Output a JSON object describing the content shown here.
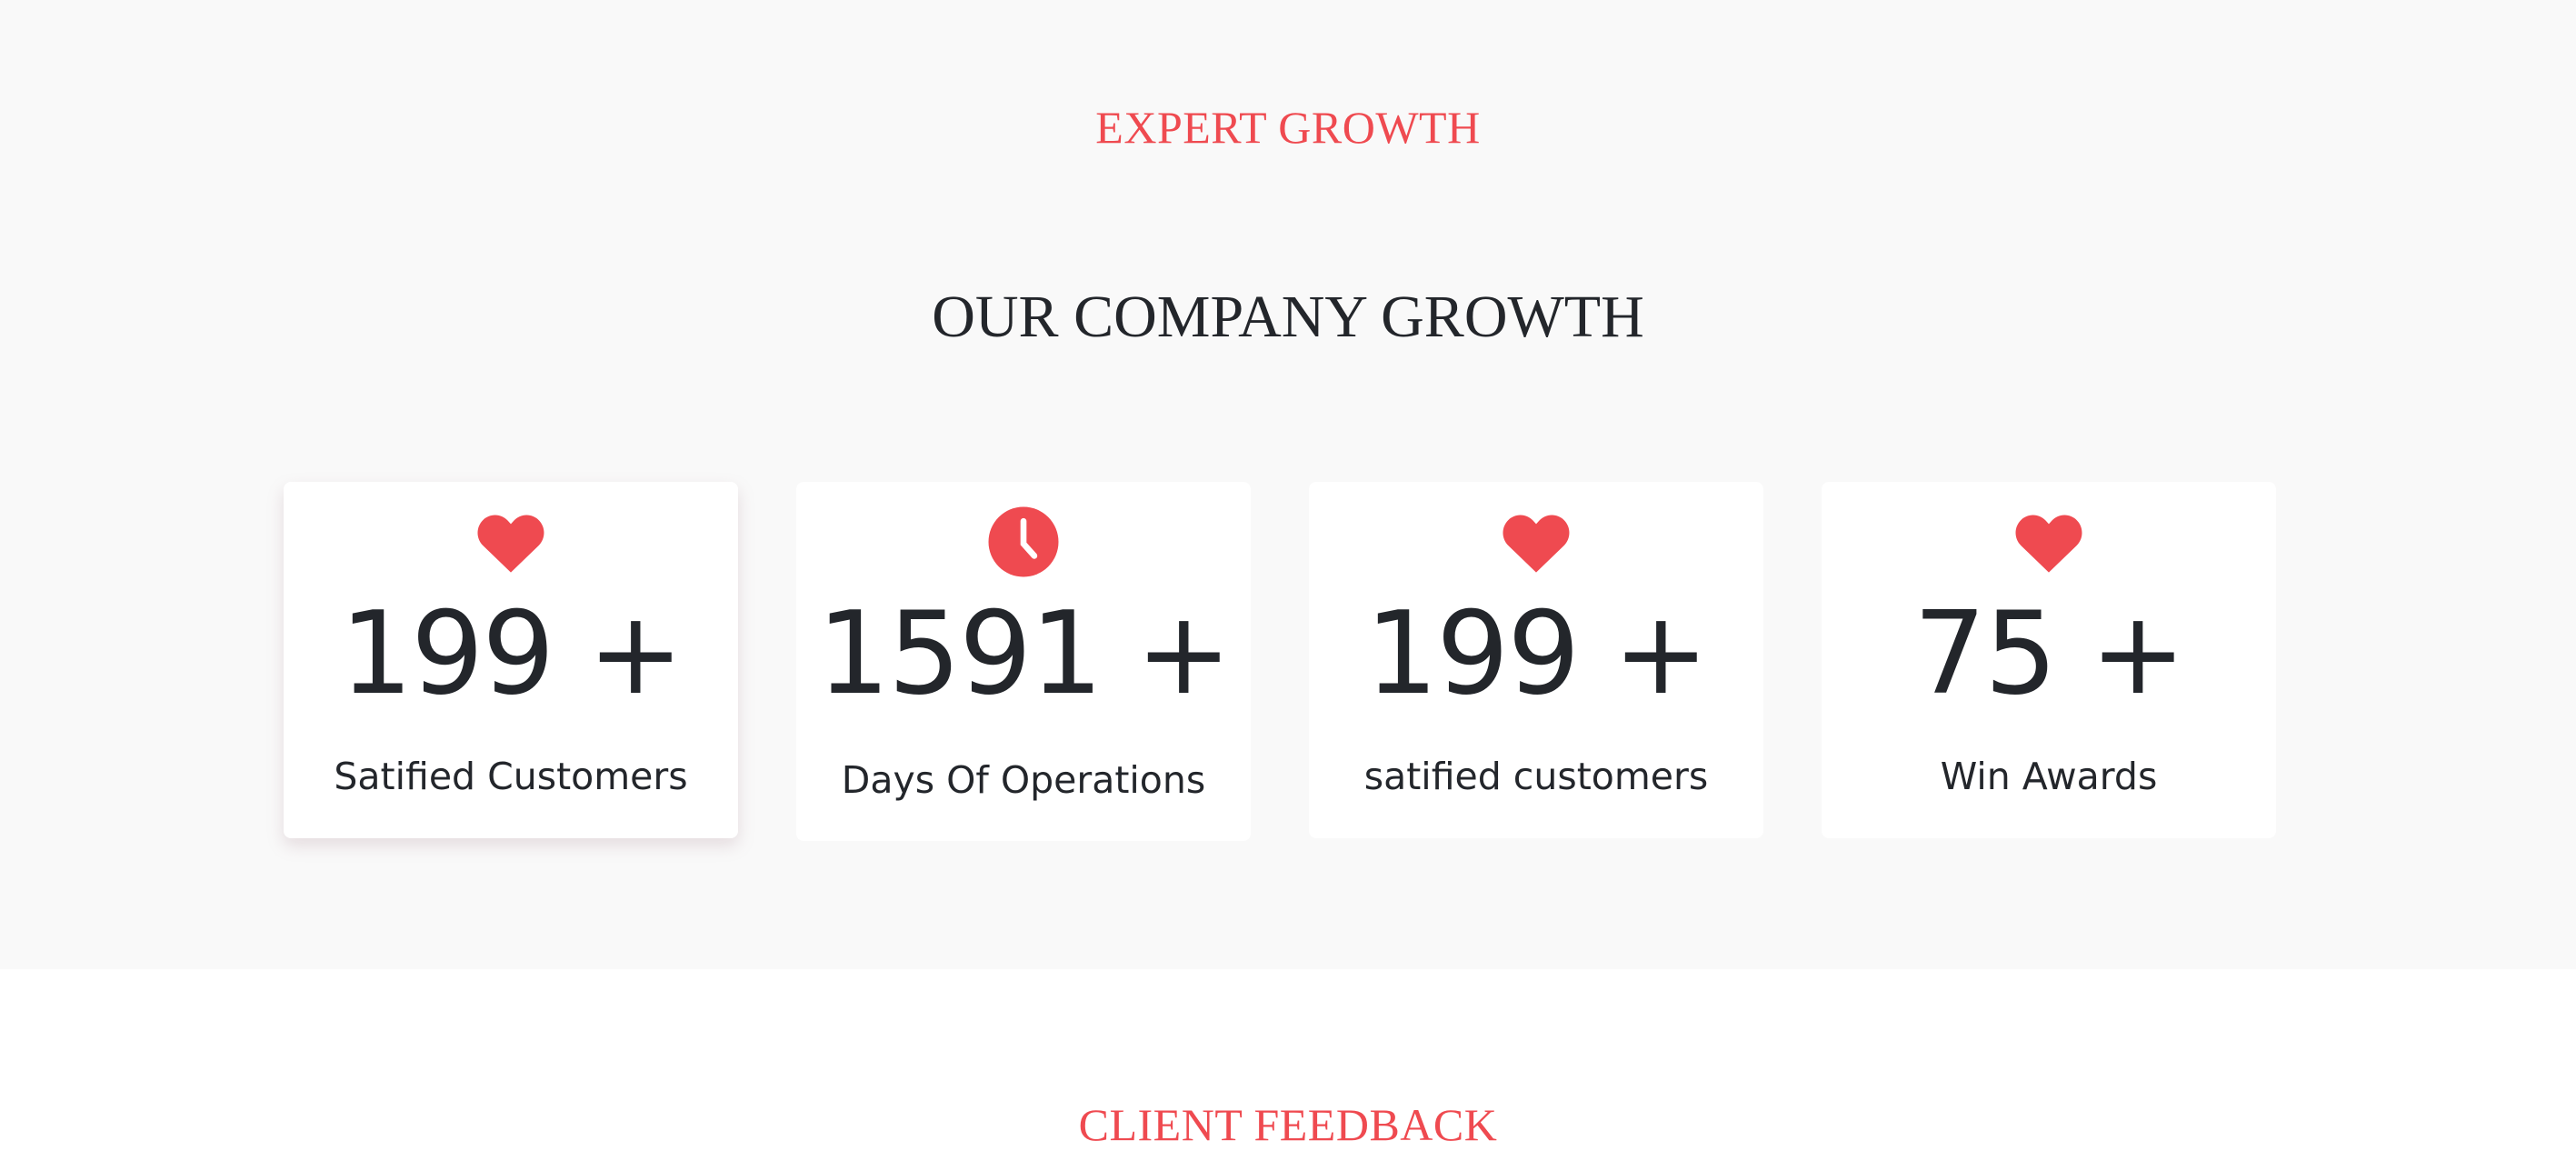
{
  "colors": {
    "accent": "#ef4a50",
    "text_dark": "#23262b",
    "section_bg": "#f9f9f9",
    "card_bg": "#ffffff"
  },
  "growth": {
    "eyebrow": "EXPERT GROWTH",
    "title": "OUR COMPANY GROWTH",
    "stats": [
      {
        "icon": "heart-icon",
        "value": "199 +",
        "label": "Satified Customers"
      },
      {
        "icon": "clock-icon",
        "value": "1591 +",
        "label": "Days Of Operations"
      },
      {
        "icon": "heart-icon",
        "value": "199 +",
        "label": "satified customers"
      },
      {
        "icon": "heart-icon",
        "value": "75 +",
        "label": "Win Awards"
      }
    ]
  },
  "feedback": {
    "eyebrow": "CLIENT FEEDBACK"
  }
}
